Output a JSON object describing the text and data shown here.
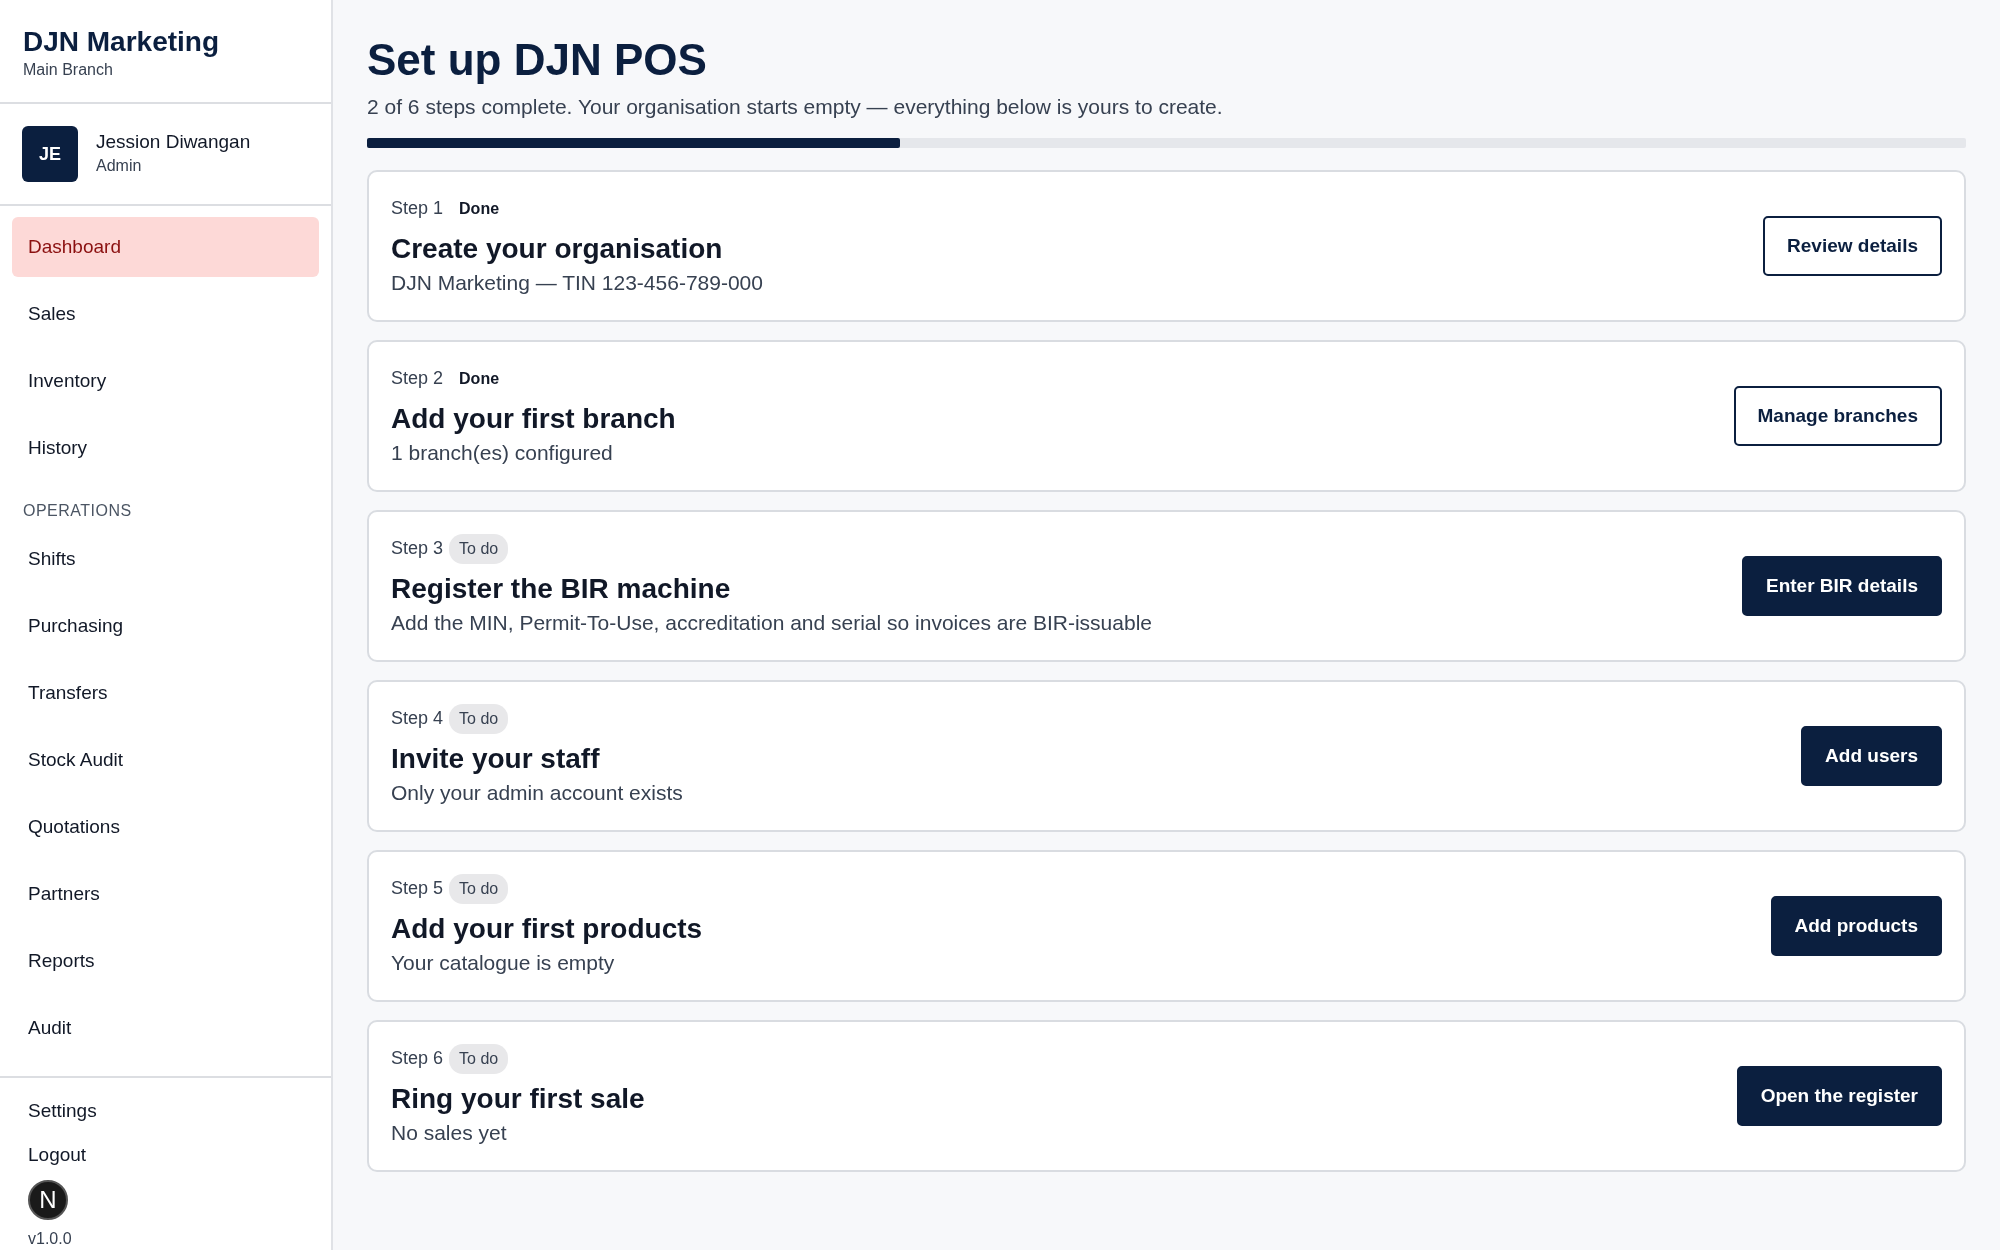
{
  "sidebar": {
    "brand": "DJN Marketing",
    "branch": "Main Branch",
    "user": {
      "initials": "JE",
      "name": "Jession Diwangan",
      "role": "Admin"
    },
    "items": [
      {
        "label": "Dashboard",
        "selected": true
      },
      {
        "label": "Sales",
        "selected": false
      },
      {
        "label": "Inventory",
        "selected": false
      },
      {
        "label": "History",
        "selected": false
      },
      {
        "kind": "section",
        "label": "OPERATIONS"
      },
      {
        "label": "Shifts",
        "selected": false
      },
      {
        "label": "Purchasing",
        "selected": false
      },
      {
        "label": "Transfers",
        "selected": false
      },
      {
        "label": "Stock Audit",
        "selected": false
      },
      {
        "label": "Quotations",
        "selected": false
      },
      {
        "label": "Partners",
        "selected": false
      },
      {
        "label": "Reports",
        "selected": false
      },
      {
        "label": "Audit",
        "selected": false
      }
    ],
    "footer_items": [
      {
        "label": "Settings"
      },
      {
        "label": "Logout"
      }
    ],
    "version": "v1.0.0"
  },
  "dev_badge": {
    "label": "N"
  },
  "main": {
    "title": "Set up DJN POS",
    "subtitle": "2 of 6 steps complete. Your organisation starts empty — everything below is yours to create.",
    "progress": {
      "level": 0.3333
    },
    "steps": [
      {
        "step": "Step 1",
        "status": "Done",
        "done": true,
        "title": "Create your organisation",
        "description": "DJN Marketing — TIN 123-456-789-000",
        "button": "Review details"
      },
      {
        "step": "Step 2",
        "status": "Done",
        "done": true,
        "title": "Add your first branch",
        "description": "1 branch(es) configured",
        "button": "Manage branches"
      },
      {
        "step": "Step 3",
        "status": "To do",
        "done": false,
        "title": "Register the BIR machine",
        "description": "Add the MIN, Permit-To-Use, accreditation and serial so invoices are BIR-issuable",
        "button": "Enter BIR details"
      },
      {
        "step": "Step 4",
        "status": "To do",
        "done": false,
        "title": "Invite your staff",
        "description": "Only your admin account exists",
        "button": "Add users"
      },
      {
        "step": "Step 5",
        "status": "To do",
        "done": false,
        "title": "Add your first products",
        "description": "Your catalogue is empty",
        "button": "Add products"
      },
      {
        "step": "Step 6",
        "status": "To do",
        "done": false,
        "title": "Ring your first sale",
        "description": "No sales yet",
        "button": "Open the register"
      }
    ]
  }
}
